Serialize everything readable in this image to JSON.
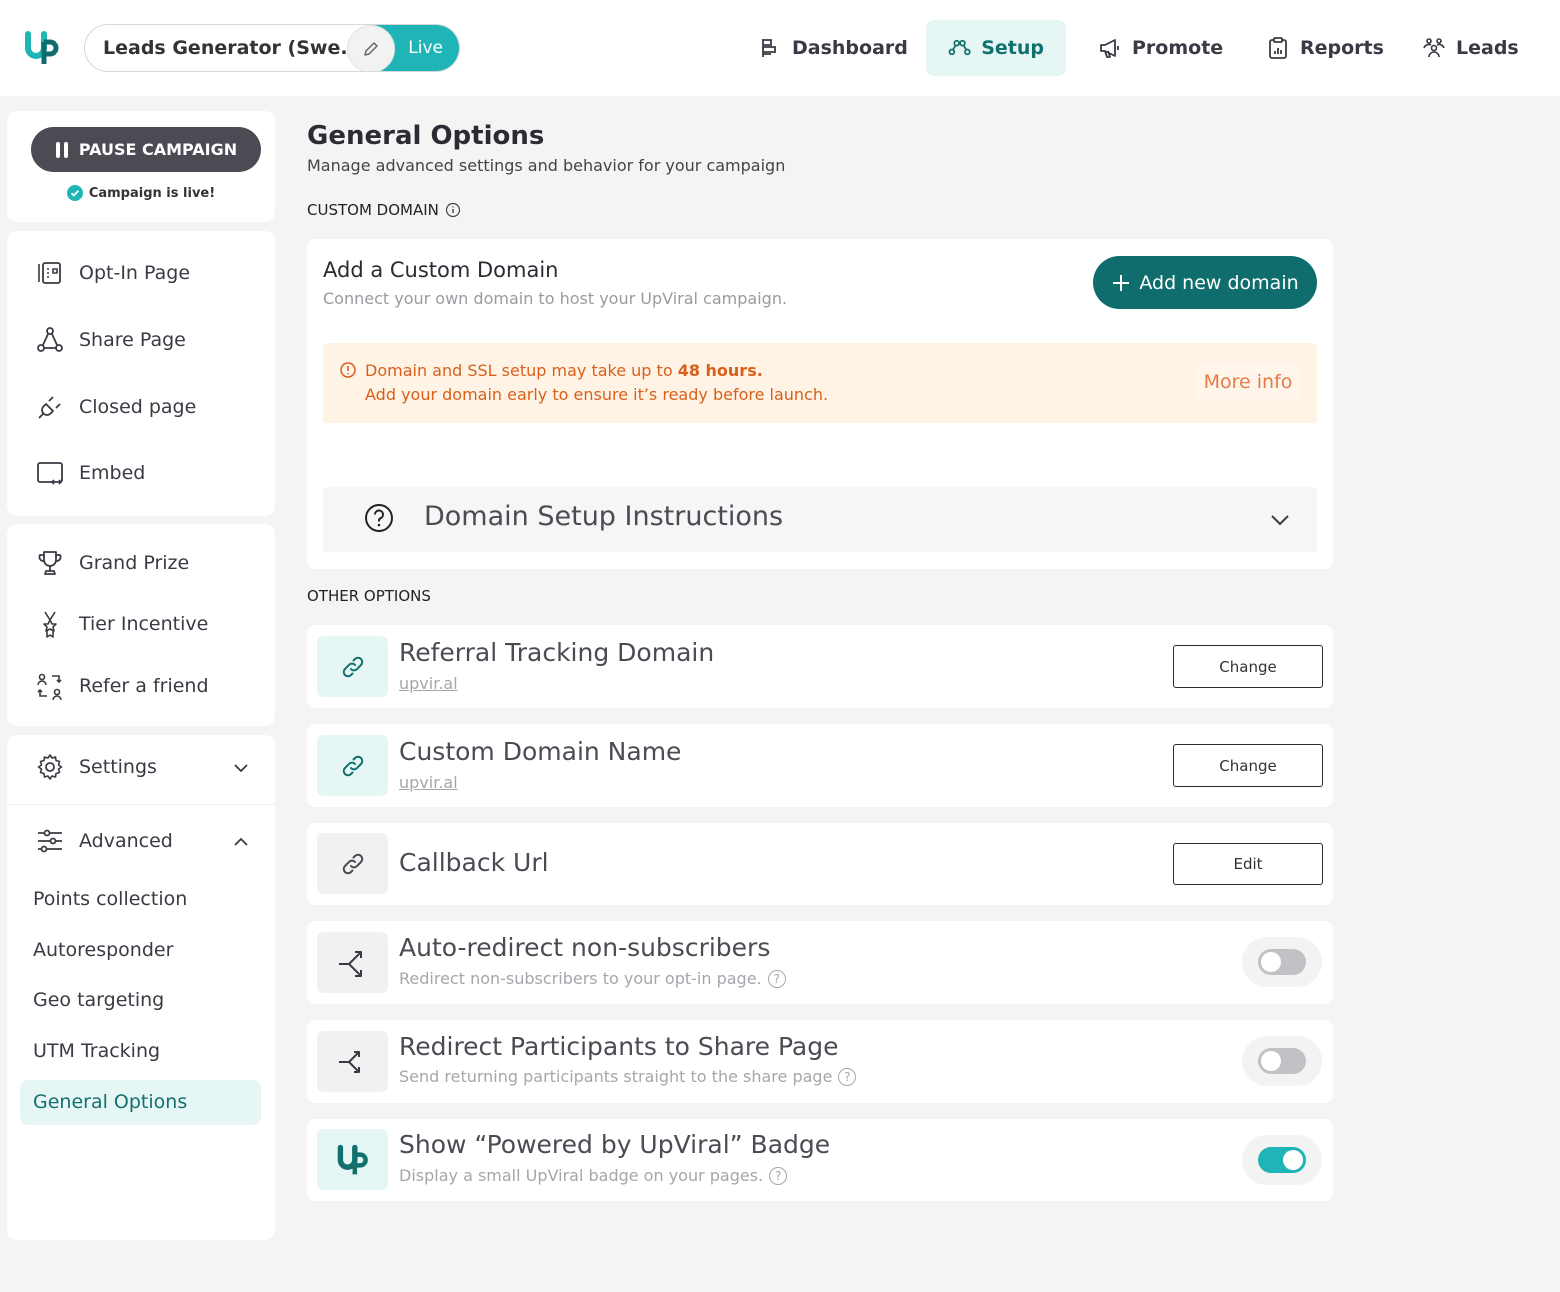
{
  "header": {
    "campaign_name": "Leads Generator (Swe...",
    "live_label": "Live",
    "nav": [
      {
        "label": "Dashboard",
        "icon": "dashboard-icon"
      },
      {
        "label": "Setup",
        "icon": "setup-icon",
        "active": true
      },
      {
        "label": "Promote",
        "icon": "megaphone-icon"
      },
      {
        "label": "Reports",
        "icon": "clipboard-chart-icon"
      },
      {
        "label": "Leads",
        "icon": "users-icon"
      }
    ]
  },
  "sidebar": {
    "pause_label": "PAUSE CAMPAIGN",
    "status_text": "Campaign is live!",
    "pages": [
      {
        "label": "Opt-In Page",
        "icon": "optin-icon"
      },
      {
        "label": "Share Page",
        "icon": "share-icon"
      },
      {
        "label": "Closed page",
        "icon": "plug-icon"
      },
      {
        "label": "Embed",
        "icon": "embed-icon"
      }
    ],
    "rewards": [
      {
        "label": "Grand Prize",
        "icon": "trophy-icon"
      },
      {
        "label": "Tier Incentive",
        "icon": "medal-icon"
      },
      {
        "label": "Refer a friend",
        "icon": "refer-icon"
      }
    ],
    "settings_label": "Settings",
    "advanced_label": "Advanced",
    "advanced_items": [
      "Points collection",
      "Autoresponder",
      "Geo targeting",
      "UTM Tracking",
      "General Options"
    ],
    "active_item": "General Options"
  },
  "main": {
    "title": "General Options",
    "subtitle": "Manage advanced settings and behavior for your campaign",
    "custom_domain_label": "CUSTOM DOMAIN",
    "domain_card": {
      "title": "Add a Custom Domain",
      "subtitle": "Connect your own domain to host your UpViral campaign.",
      "add_button": "Add new domain",
      "warning_line1_prefix": "Domain and SSL setup may take up to ",
      "warning_line1_bold": "48 hours.",
      "warning_line2": "Add your domain early to ensure it’s ready before launch.",
      "more_info": "More info",
      "instructions_title": "Domain Setup Instructions"
    },
    "other_options_label": "OTHER OPTIONS",
    "options": [
      {
        "title": "Referral Tracking Domain",
        "link": "upvir.al",
        "button": "Change"
      },
      {
        "title": "Custom Domain Name",
        "link": "upvir.al",
        "button": "Change"
      },
      {
        "title": "Callback Url",
        "button": "Edit"
      },
      {
        "title": "Auto-redirect non-subscribers",
        "subtitle": "Redirect non-subscribers to your opt-in page.",
        "enabled": false
      },
      {
        "title": "Redirect Participants to Share Page",
        "subtitle": "Send returning participants straight to the share page",
        "enabled": false
      },
      {
        "title": "Show “Powered by UpViral” Badge",
        "subtitle": "Display a small UpViral badge on your pages.",
        "enabled": true
      }
    ]
  },
  "colors": {
    "accent": "#1fb5b7",
    "brand_dark": "#0f6e6d",
    "warning": "#d9601c"
  }
}
